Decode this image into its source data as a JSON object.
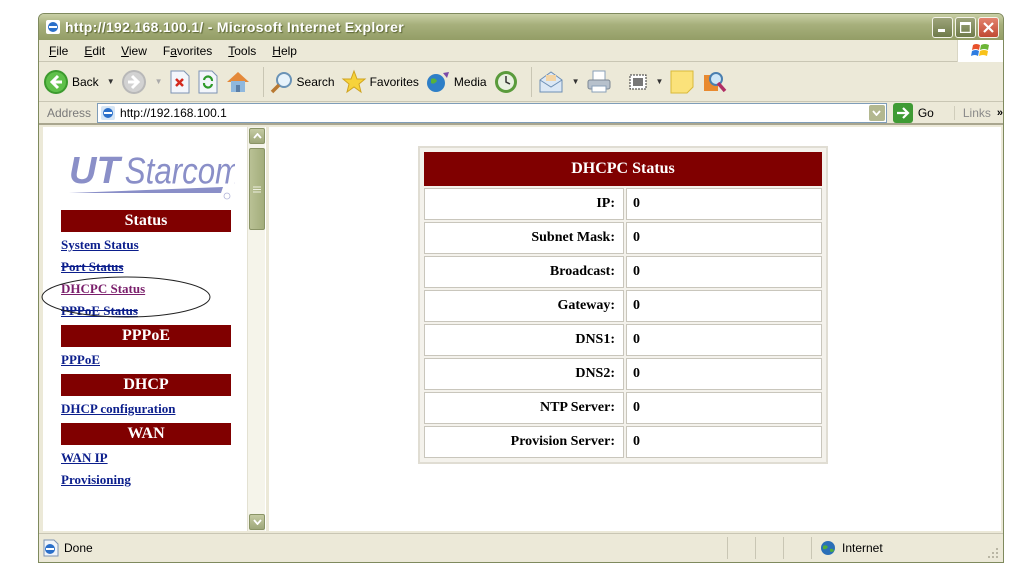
{
  "window": {
    "title": "http://192.168.100.1/ - Microsoft Internet Explorer"
  },
  "menu": [
    {
      "label": "File",
      "accel": "F"
    },
    {
      "label": "Edit",
      "accel": "E"
    },
    {
      "label": "View",
      "accel": "V"
    },
    {
      "label": "Favorites",
      "accel": "a"
    },
    {
      "label": "Tools",
      "accel": "T"
    },
    {
      "label": "Help",
      "accel": "H"
    }
  ],
  "toolbar": {
    "back_label": "Back",
    "search_label": "Search",
    "favorites_label": "Favorites",
    "media_label": "Media"
  },
  "address": {
    "label": "Address",
    "url": "http://192.168.100.1",
    "go_label": "Go",
    "links_label": "Links",
    "links_chevron": "»"
  },
  "sidebar": {
    "logo_text": "UTStarcom",
    "groups": [
      {
        "header": "Status",
        "links": [
          {
            "label": "System Status",
            "state": "normal"
          },
          {
            "label": "Port Status",
            "state": "struck"
          },
          {
            "label": "DHCPC Status",
            "state": "visited-highlighted"
          },
          {
            "label": "PPPoE Status",
            "state": "struck"
          }
        ]
      },
      {
        "header": "PPPoE",
        "links": [
          {
            "label": "PPPoE",
            "state": "normal"
          }
        ]
      },
      {
        "header": "DHCP",
        "links": [
          {
            "label": "DHCP configuration",
            "state": "normal"
          }
        ]
      },
      {
        "header": "WAN",
        "links": [
          {
            "label": "WAN IP",
            "state": "normal"
          },
          {
            "label": "Provisioning",
            "state": "normal"
          }
        ]
      }
    ]
  },
  "dhcpc_status": {
    "title": "DHCPC Status",
    "rows": [
      {
        "label": "IP:",
        "value": "0"
      },
      {
        "label": "Subnet Mask:",
        "value": "0"
      },
      {
        "label": "Broadcast:",
        "value": "0"
      },
      {
        "label": "Gateway:",
        "value": "0"
      },
      {
        "label": "DNS1:",
        "value": "0"
      },
      {
        "label": "DNS2:",
        "value": "0"
      },
      {
        "label": "NTP Server:",
        "value": "0"
      },
      {
        "label": "Provision Server:",
        "value": "0"
      }
    ]
  },
  "statusbar": {
    "status": "Done",
    "zone": "Internet"
  },
  "colors": {
    "header_bg": "#800000",
    "link": "#0b1e8c",
    "visited_link": "#7a1e6b",
    "logo": "#8a8fc8"
  }
}
